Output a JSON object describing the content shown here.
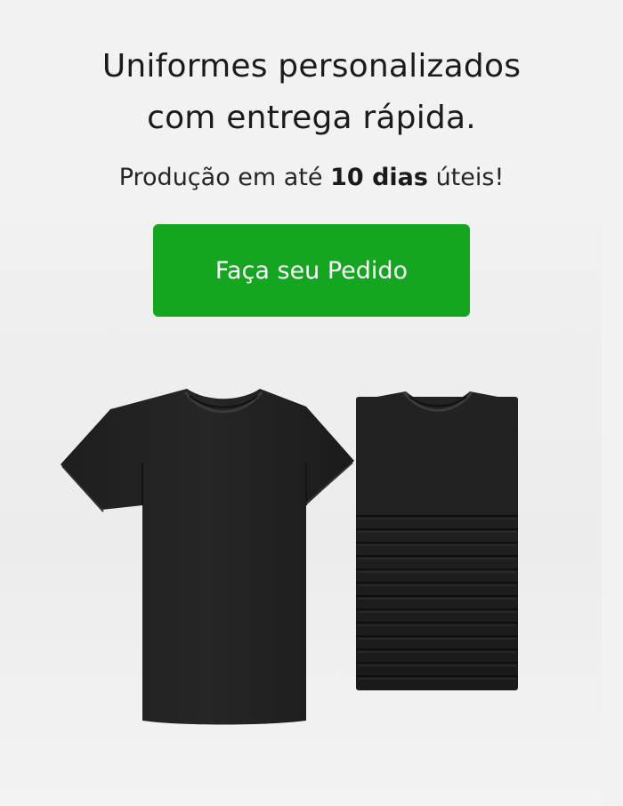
{
  "hero": {
    "headline_line1": "Uniformes personalizados",
    "headline_line2": "com entrega rápida.",
    "subtitle_prefix": "Produção em até ",
    "subtitle_bold": "10 dias",
    "subtitle_suffix": " úteis!",
    "cta_label": "Faça seu Pedido"
  },
  "colors": {
    "background": "#f2f2f2",
    "cta_background": "#14a521",
    "cta_text": "#ffffff",
    "shirt": "#1c1c1c"
  }
}
